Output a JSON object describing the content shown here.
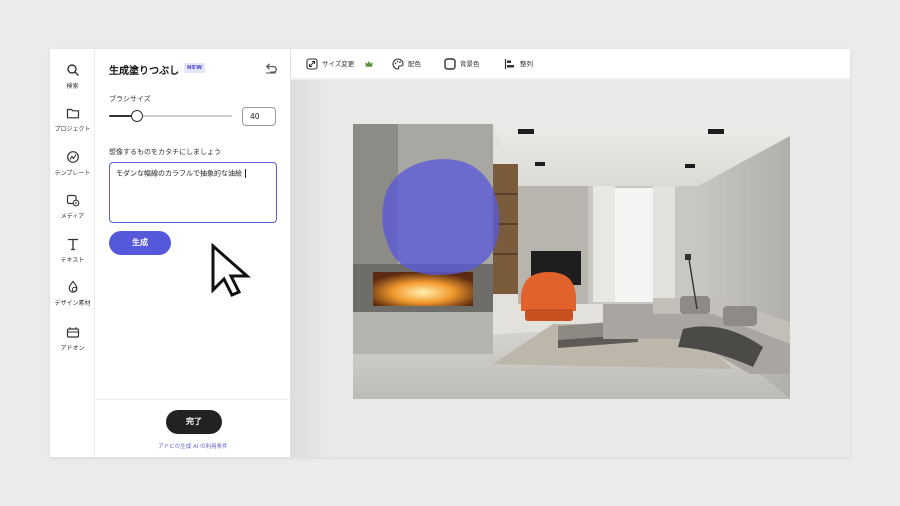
{
  "rail": {
    "items": [
      {
        "label": "検索",
        "icon": "search-icon"
      },
      {
        "label": "プロジェクト",
        "icon": "folder-icon"
      },
      {
        "label": "テンプレート",
        "icon": "template-icon"
      },
      {
        "label": "メディア",
        "icon": "media-icon"
      },
      {
        "label": "テキスト",
        "icon": "text-icon"
      },
      {
        "label": "デザイン素材",
        "icon": "design-assets-icon"
      },
      {
        "label": "アドオン",
        "icon": "addons-icon"
      }
    ]
  },
  "panel": {
    "title": "生成塗りつぶし",
    "badge": "NEW",
    "brush_label": "ブラシサイズ",
    "brush_size": "40",
    "brush_level": 0.23,
    "prompt_label": "想像するものをカタチにしましょう",
    "prompt_value": "モダンな幅線のカラフルで抽象的な油絵",
    "generate_label": "生成",
    "done_label": "完了",
    "terms_text": "アドビの生成 AI の利用条件"
  },
  "toolbar": {
    "resize_label": "サイズ変更",
    "color_label": "配色",
    "background_label": "背景色",
    "align_label": "整列"
  },
  "colors": {
    "accent": "#5558d9",
    "brush_overlay": "#5a5ad8"
  }
}
